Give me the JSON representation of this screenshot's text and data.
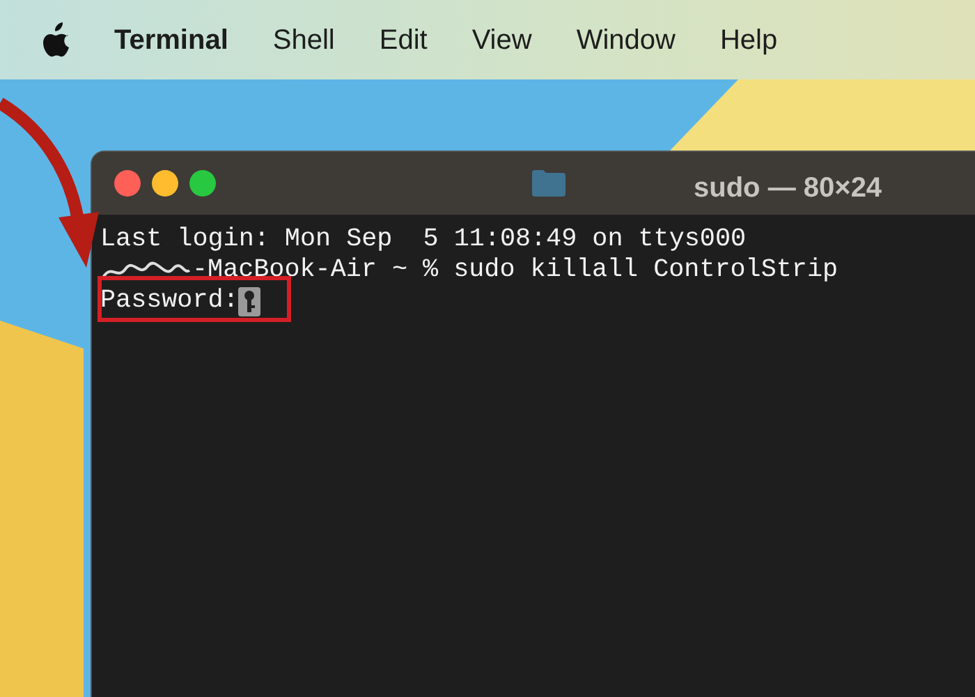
{
  "menu_bar": {
    "items": [
      {
        "label": "Terminal",
        "kind": "app"
      },
      {
        "label": "Shell",
        "kind": "menu"
      },
      {
        "label": "Edit",
        "kind": "menu"
      },
      {
        "label": "View",
        "kind": "menu"
      },
      {
        "label": "Window",
        "kind": "menu"
      },
      {
        "label": "Help",
        "kind": "menu"
      }
    ]
  },
  "window": {
    "title": "sudo — 80×24",
    "lines": [
      {
        "kind": "output",
        "text": "Last login: Mon Sep  5 11:08:49 on ttys000"
      },
      {
        "kind": "prompt",
        "text": "-MacBook-Air ~ % sudo killall ControlStrip"
      },
      {
        "kind": "password",
        "text": "Password:"
      }
    ]
  }
}
